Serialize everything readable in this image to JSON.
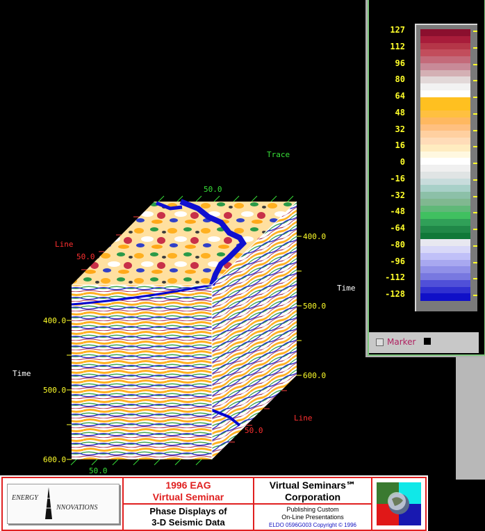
{
  "viewer": {
    "axis_labels": {
      "trace": "Trace",
      "line_left": "Line",
      "line_right": "Line",
      "time_left": "Time",
      "time_right": "Time"
    },
    "ticks": {
      "trace_top": "50.0",
      "line_top": "50.0",
      "right_400": "400.0",
      "right_500": "500.0",
      "right_600": "600.0",
      "left_400": "400.0",
      "left_500": "500.0",
      "left_600": "600.0",
      "bottom_trace": "50.0",
      "bottom_line": "50.0"
    }
  },
  "colorbar": {
    "labels": [
      "127",
      "112",
      "96",
      "80",
      "64",
      "48",
      "32",
      "16",
      "0",
      "-16",
      "-32",
      "-48",
      "-64",
      "-80",
      "-96",
      "-112",
      "-128"
    ],
    "colors": [
      "#8b0f2e",
      "#a81c3a",
      "#b53648",
      "#c24d5c",
      "#c46a7a",
      "#c88a98",
      "#d4b0b4",
      "#e2d8d8",
      "#f2f2f2",
      "#ffffff",
      "#ffc020",
      "#ffc020",
      "#ffc040",
      "#ffb860",
      "#ffc080",
      "#ffd0a0",
      "#ffdcb8",
      "#ffecc0",
      "#fff8e0",
      "#ffffff",
      "#f0f0f0",
      "#e0e4e4",
      "#c8dcdc",
      "#a8d0c8",
      "#8cc0a8",
      "#80b890",
      "#60b878",
      "#40c060",
      "#30a058",
      "#208848",
      "#107838",
      "#e8e8f0",
      "#d8d8f8",
      "#c0c0f8",
      "#a8a8f0",
      "#9090e8",
      "#7878e0",
      "#5050d8",
      "#3030d0",
      "#1010c8"
    ],
    "marker_label": "Marker"
  },
  "banner": {
    "logo_line1": "ENERGY",
    "logo_line2": "NNOVATIONS",
    "eag_line1": "1996 EAG",
    "eag_line2": "Virtual Seminar",
    "phase_line1": "Phase Displays of",
    "phase_line2": "3-D Seismic Data",
    "vs_line1": "Virtual Seminars℠",
    "vs_line2": "Corporation",
    "pub_line1": "Publishing Custom",
    "pub_line2": "On-Line Presentations",
    "copyright": "ELDO 0596G003 Copyright © 1996"
  }
}
